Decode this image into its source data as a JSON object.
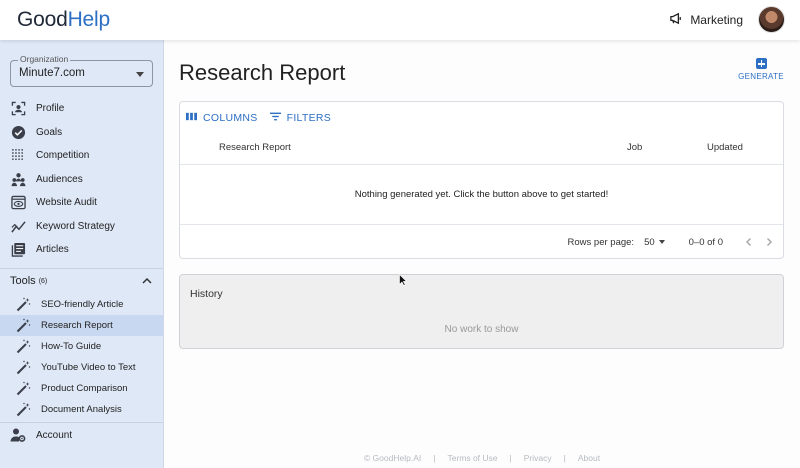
{
  "header": {
    "logo_part1": "Good",
    "logo_part2": "Help",
    "workspace": "Marketing",
    "workspace_icon": "megaphone-icon"
  },
  "sidebar": {
    "organization_label": "Organization",
    "organization_value": "Minute7.com",
    "nav": [
      {
        "label": "Profile",
        "icon": "profile-frame-icon"
      },
      {
        "label": "Goals",
        "icon": "check-circle-icon"
      },
      {
        "label": "Competition",
        "icon": "dots-grid-icon"
      },
      {
        "label": "Audiences",
        "icon": "people-icon"
      },
      {
        "label": "Website Audit",
        "icon": "eye-window-icon"
      },
      {
        "label": "Keyword Strategy",
        "icon": "trend-icon"
      },
      {
        "label": "Articles",
        "icon": "articles-icon"
      }
    ],
    "tools_label": "Tools",
    "tools_count": "(6)",
    "tools": [
      {
        "label": "SEO-friendly Article",
        "active": false
      },
      {
        "label": "Research Report",
        "active": true
      },
      {
        "label": "How-To Guide",
        "active": false
      },
      {
        "label": "YouTube Video to Text",
        "active": false
      },
      {
        "label": "Product Comparison",
        "active": false
      },
      {
        "label": "Document Analysis",
        "active": false
      }
    ],
    "account_label": "Account"
  },
  "main": {
    "title": "Research Report",
    "generate_label": "GENERATE",
    "toolbar": {
      "columns_label": "COLUMNS",
      "filters_label": "FILTERS"
    },
    "table": {
      "headers": [
        "Research Report",
        "Job",
        "Updated"
      ],
      "empty_message": "Nothing generated yet. Click the button above to get started!"
    },
    "pagination": {
      "rows_per_page_label": "Rows per page:",
      "rows_per_page_value": "50",
      "range": "0–0 of 0"
    },
    "history": {
      "title": "History",
      "empty_message": "No work to show"
    }
  },
  "footer": {
    "copyright": "© GoodHelp.AI",
    "links": [
      "Terms of Use",
      "Privacy",
      "About"
    ]
  },
  "colors": {
    "accent": "#2c6fc4",
    "sidebar_bg": "#dfe8f7",
    "active_item_bg": "#c9d8f1"
  }
}
